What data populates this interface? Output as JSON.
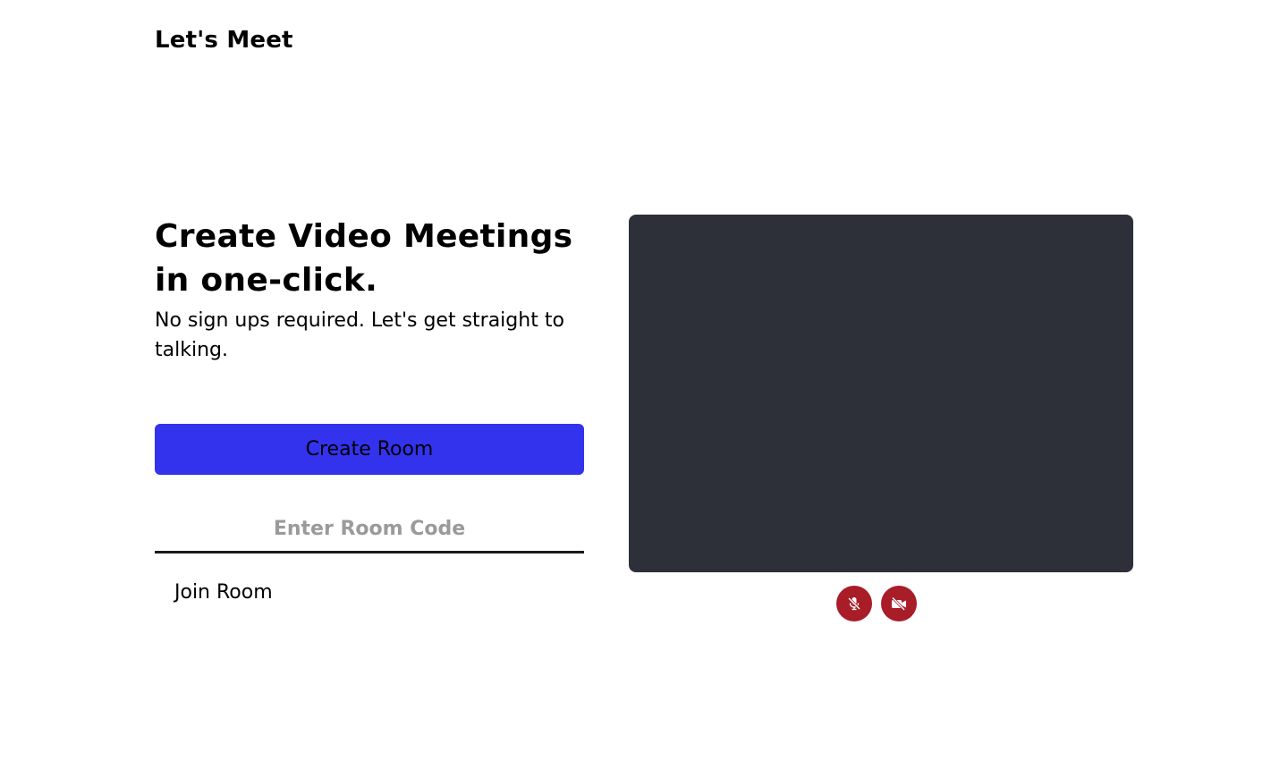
{
  "app": {
    "title": "Let's Meet"
  },
  "hero": {
    "headline": "Create Video Meetings in one-click.",
    "subline": "No sign ups required. Let's get straight to talking."
  },
  "actions": {
    "create_label": "Create Room",
    "room_code_placeholder": "Enter Room Code",
    "room_code_value": "",
    "join_label": "Join Room"
  },
  "preview": {
    "mic_icon": "mic-off-icon",
    "camera_icon": "video-off-icon"
  },
  "colors": {
    "accent": "#3333ee",
    "preview_background": "#2d3038",
    "control_off": "#a81d27",
    "text": "#000000",
    "placeholder": "#9a9a9a"
  }
}
